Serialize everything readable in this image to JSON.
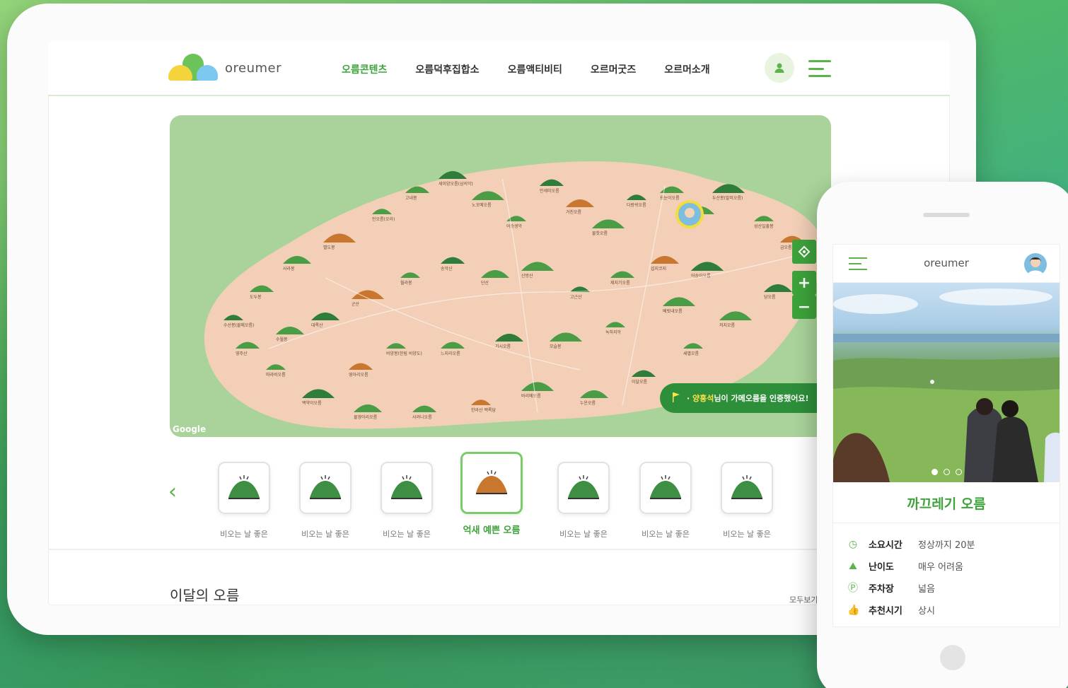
{
  "tablet": {
    "logo_text": "oreumer",
    "nav": [
      {
        "label": "오름콘텐츠",
        "active": true
      },
      {
        "label": "오름덕후집합소",
        "active": false
      },
      {
        "label": "오름액티비티",
        "active": false
      },
      {
        "label": "오르머굿즈",
        "active": false
      },
      {
        "label": "오르머소개",
        "active": false
      }
    ],
    "map": {
      "google_label": "Google",
      "controls": [
        "location-icon",
        "plus-icon",
        "minus-icon"
      ],
      "toast": {
        "prefix": "·",
        "name": "양흥석",
        "message": "님이 가메오름을 인증했어요!"
      },
      "labels": [
        "수산봉(물메오름)",
        "도두봉",
        "사라봉",
        "별도봉",
        "민오름(오라)",
        "고내봉",
        "세미양오름(삼의악)",
        "노꼬메오름",
        "어승생악",
        "안세미오름",
        "거친오름",
        "물찻오름",
        "다랑쉬오름",
        "용눈이오름",
        "지미봉",
        "두산봉(말미오름)",
        "성산일출봉",
        "금오름",
        "당오름",
        "저지오름",
        "새별오름",
        "이달오름",
        "누운오름",
        "바리메오름",
        "한라산 백록담",
        "사려니오름",
        "물영아리오름",
        "백약이오름",
        "따라비오름",
        "영주산",
        "대록산",
        "군산",
        "월라봉",
        "송악산",
        "단산",
        "산방산",
        "고근산",
        "제지기오름",
        "섭지코지",
        "어승이오름",
        "비양봉(한림 비양도)",
        "느지리오름",
        "가시오름",
        "모슬봉",
        "녹하지악",
        "영아리오름",
        "수월봉",
        "베릿내오름"
      ]
    },
    "carousel": {
      "items": [
        {
          "label": "비오는 날 좋은",
          "active": false
        },
        {
          "label": "비오는 날 좋은",
          "active": false
        },
        {
          "label": "비오는 날 좋은",
          "active": false
        },
        {
          "label": "억새 예쁜 오름",
          "active": true
        },
        {
          "label": "비오는 날 좋은",
          "active": false
        },
        {
          "label": "비오는 날 좋은",
          "active": false
        },
        {
          "label": "비오는 날 좋은",
          "active": false
        }
      ]
    },
    "section_title": "이달의 오름",
    "see_all": "모두보기 ›"
  },
  "phone": {
    "title": "oreumer",
    "oreum_name": "까끄레기 오름",
    "info": [
      {
        "icon": "clock-icon",
        "glyph": "◷",
        "key": "소요시간",
        "value": "정상까지 20분"
      },
      {
        "icon": "mountain-icon",
        "glyph": "⛰",
        "key": "난이도",
        "value": "매우 어려움"
      },
      {
        "icon": "parking-icon",
        "glyph": "Ⓟ",
        "key": "주차장",
        "value": "넓음"
      },
      {
        "icon": "thumbs-up-icon",
        "glyph": "👍",
        "key": "추천시기",
        "value": "상시"
      }
    ]
  },
  "colors": {
    "accent": "#3da33a",
    "map_land": "#f2cfb6",
    "map_sea": "#a9d39a",
    "toast": "#2d8f3a"
  }
}
